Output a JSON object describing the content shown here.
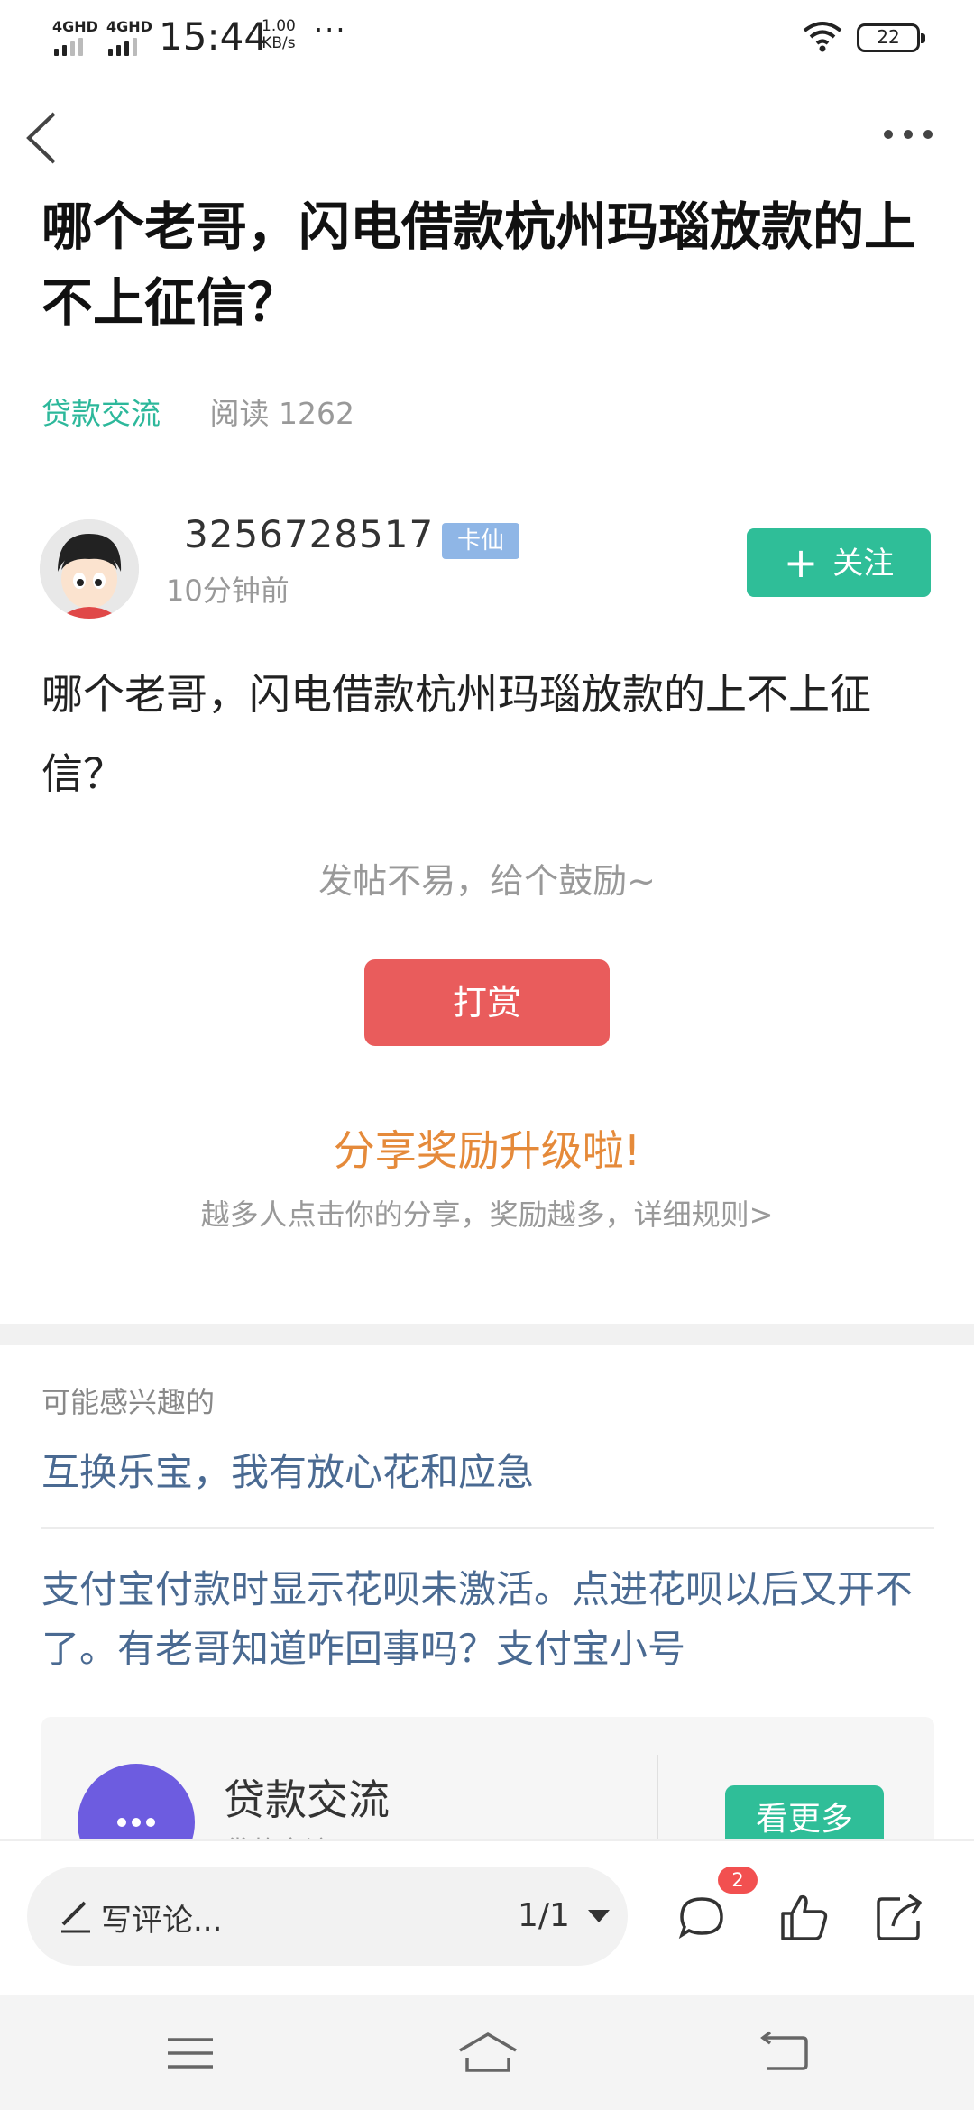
{
  "status": {
    "net1": "4GHD",
    "net2": "4GHD",
    "time": "15:44",
    "speed_value": "1.00",
    "speed_unit": "KB/s",
    "dots": "···",
    "battery": "22"
  },
  "post": {
    "title": "哪个老哥，闪电借款杭州玛瑙放款的上不上征信？",
    "category": "贷款交流",
    "read_label": "阅读 1262",
    "author": {
      "name": "3256728517",
      "badge": "卡仙",
      "time": "10分钟前"
    },
    "follow_label": "关注",
    "body": "哪个老哥，闪电借款杭州玛瑙放款的上不上征信？"
  },
  "reward": {
    "prompt": "发帖不易，给个鼓励~",
    "button": "打赏"
  },
  "share": {
    "title": "分享奖励升级啦!",
    "subtitle": "越多人点击你的分享，奖励越多，详细规则>"
  },
  "related": {
    "heading": "可能感兴趣的",
    "items": [
      "互换乐宝，我有放心花和应急",
      "支付宝付款时显示花呗未激活。点进花呗以后又开不了。有老哥知道咋回事吗？支付宝小号"
    ]
  },
  "forum_card": {
    "title": "贷款交流",
    "subtitle": "贷款交流",
    "button": "看更多"
  },
  "bottom": {
    "write_placeholder": "写评论...",
    "pager": "1/1",
    "comment_count": "2"
  },
  "colors": {
    "accent": "#2fbe98",
    "reward": "#e95c5c",
    "share_title": "#e58a3a",
    "link": "#4a6a92",
    "badge": "#8fb6e6",
    "notification": "#f25050"
  }
}
